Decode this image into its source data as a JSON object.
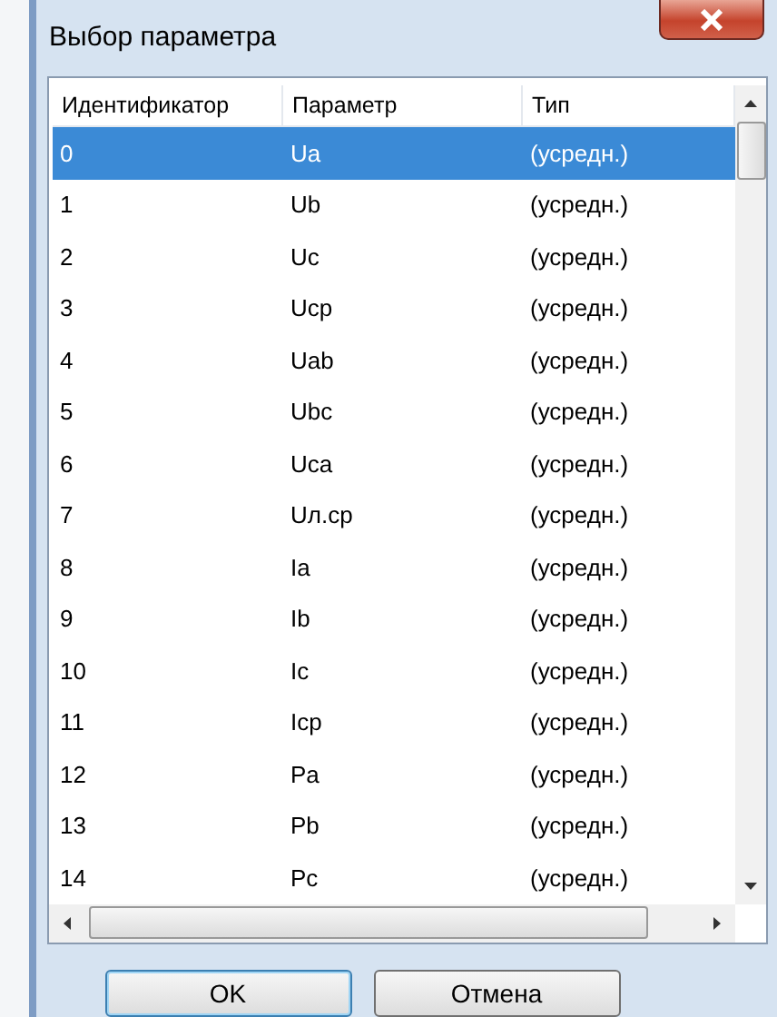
{
  "window": {
    "title": "Выбор параметра"
  },
  "table": {
    "columns": [
      "Идентификатор",
      "Параметр",
      "Тип"
    ],
    "rows": [
      {
        "cells": [
          "0",
          "Ua",
          "(усредн.)"
        ],
        "selected": true
      },
      {
        "cells": [
          "1",
          "Ub",
          "(усредн.)"
        ],
        "selected": false
      },
      {
        "cells": [
          "2",
          "Uc",
          "(усредн.)"
        ],
        "selected": false
      },
      {
        "cells": [
          "3",
          "Ucp",
          "(усредн.)"
        ],
        "selected": false
      },
      {
        "cells": [
          "4",
          "Uab",
          "(усредн.)"
        ],
        "selected": false
      },
      {
        "cells": [
          "5",
          "Ubc",
          "(усредн.)"
        ],
        "selected": false
      },
      {
        "cells": [
          "6",
          "Uca",
          "(усредн.)"
        ],
        "selected": false
      },
      {
        "cells": [
          "7",
          "Uл.cp",
          "(усредн.)"
        ],
        "selected": false
      },
      {
        "cells": [
          "8",
          "Ia",
          "(усредн.)"
        ],
        "selected": false
      },
      {
        "cells": [
          "9",
          "Ib",
          "(усредн.)"
        ],
        "selected": false
      },
      {
        "cells": [
          "10",
          "Ic",
          "(усредн.)"
        ],
        "selected": false
      },
      {
        "cells": [
          "11",
          "Icp",
          "(усредн.)"
        ],
        "selected": false
      },
      {
        "cells": [
          "12",
          "Pa",
          "(усредн.)"
        ],
        "selected": false
      },
      {
        "cells": [
          "13",
          "Pb",
          "(усредн.)"
        ],
        "selected": false
      },
      {
        "cells": [
          "14",
          "Pc",
          "(усредн.)"
        ],
        "selected": false
      }
    ]
  },
  "buttons": [
    {
      "label": "OK",
      "default": true
    },
    {
      "label": "Отмена",
      "default": false
    }
  ]
}
